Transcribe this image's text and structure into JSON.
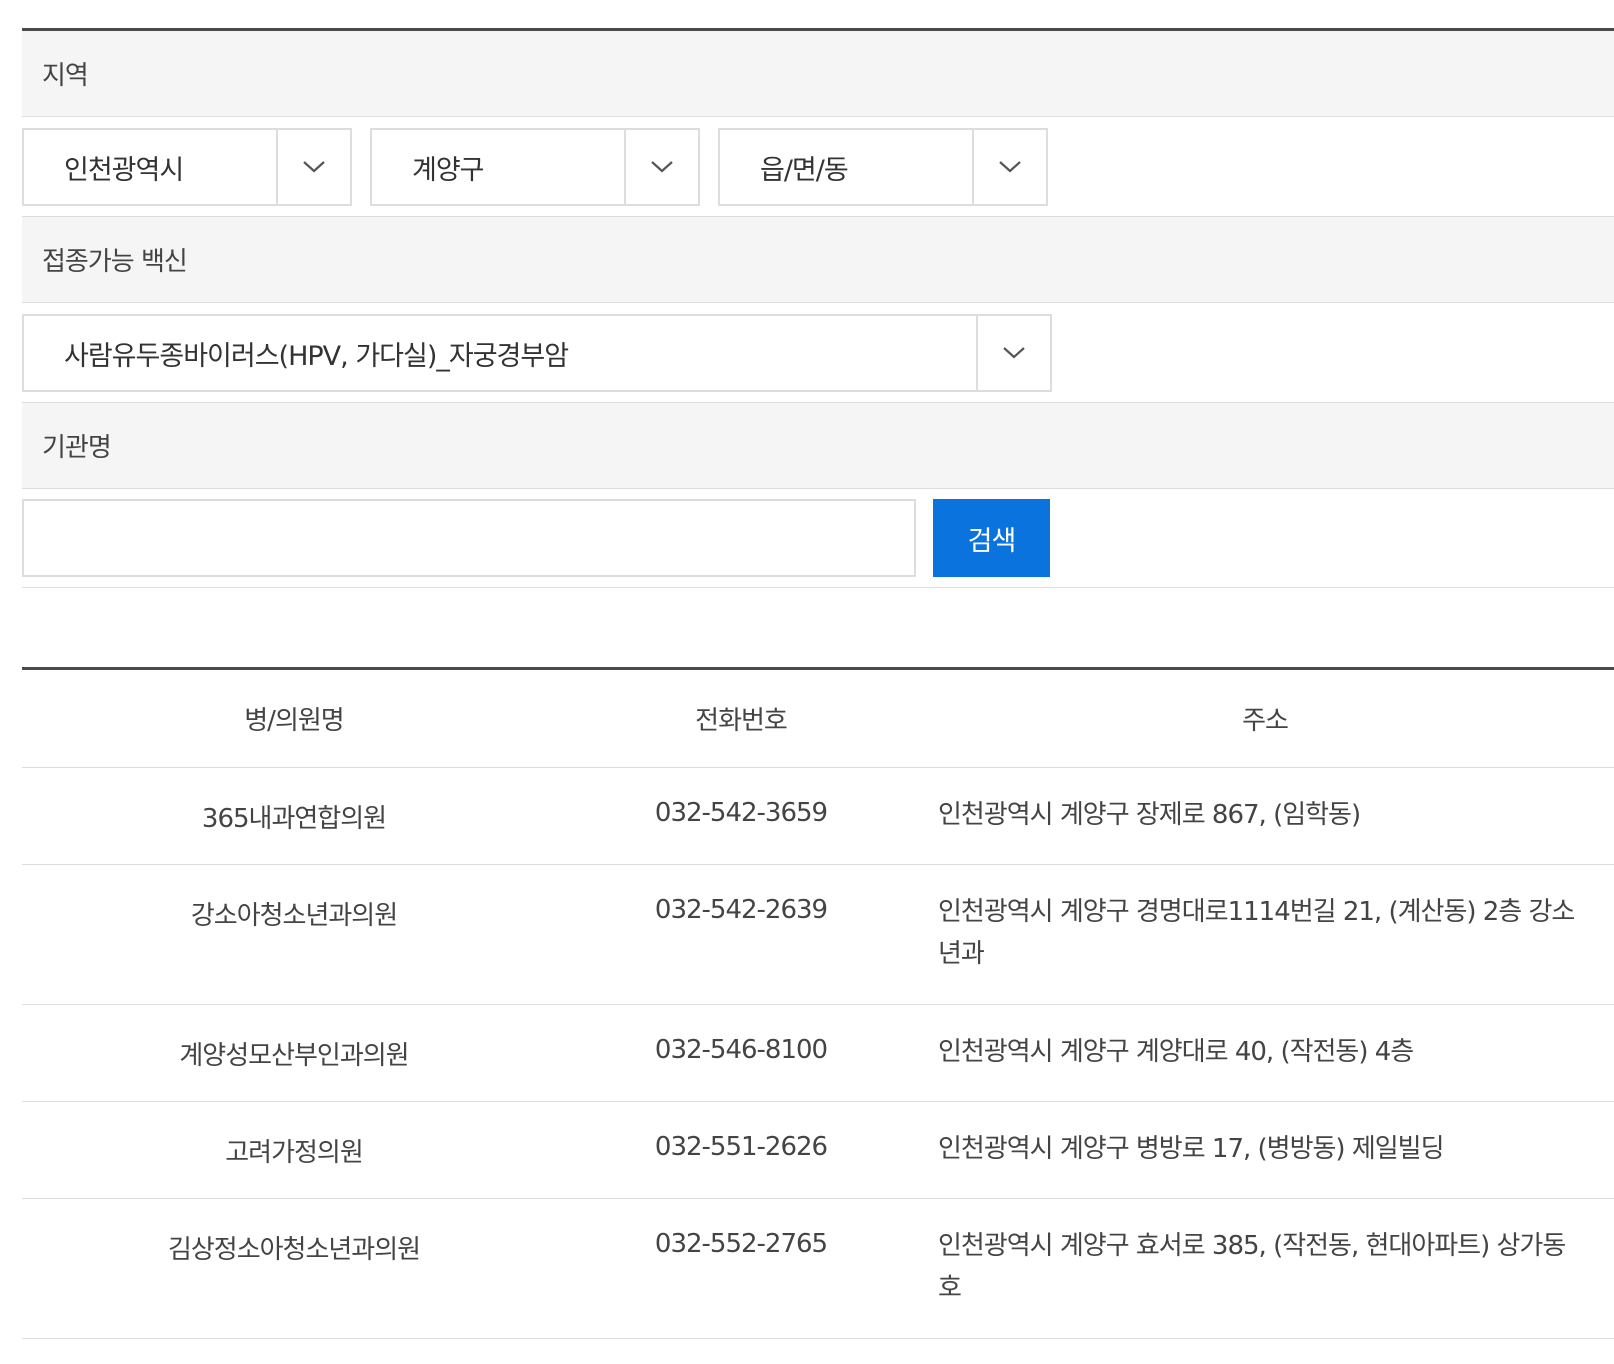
{
  "filters": {
    "region_label": "지역",
    "sido": "인천광역시",
    "sigungu": "계양구",
    "dong": "읍/면/동",
    "vaccine_label": "접종가능 백신",
    "vaccine": "사람유두종바이러스(HPV, 가다실)_자궁경부암",
    "org_label": "기관명",
    "org_value": "",
    "search_label": "검색"
  },
  "table": {
    "headers": [
      "병/의원명",
      "전화번호",
      "주소"
    ],
    "rows": [
      {
        "name": "365내과연합의원",
        "phone": "032-542-3659",
        "address": "인천광역시 계양구 장제로 867, (임학동)",
        "address_cont": ""
      },
      {
        "name": "강소아청소년과의원",
        "phone": "032-542-2639",
        "address": "인천광역시 계양구 경명대로1114번길 21, (계산동) 2층 강소",
        "address_cont": "년과"
      },
      {
        "name": "계양성모산부인과의원",
        "phone": "032-546-8100",
        "address": "인천광역시 계양구 계양대로 40, (작전동) 4층",
        "address_cont": ""
      },
      {
        "name": "고려가정의원",
        "phone": "032-551-2626",
        "address": "인천광역시 계양구 병방로 17, (병방동) 제일빌딩",
        "address_cont": ""
      },
      {
        "name": "김상정소아청소년과의원",
        "phone": "032-552-2765",
        "address": "인천광역시 계양구 효서로 385, (작전동, 현대아파트) 상가동",
        "address_cont": "호"
      }
    ]
  }
}
